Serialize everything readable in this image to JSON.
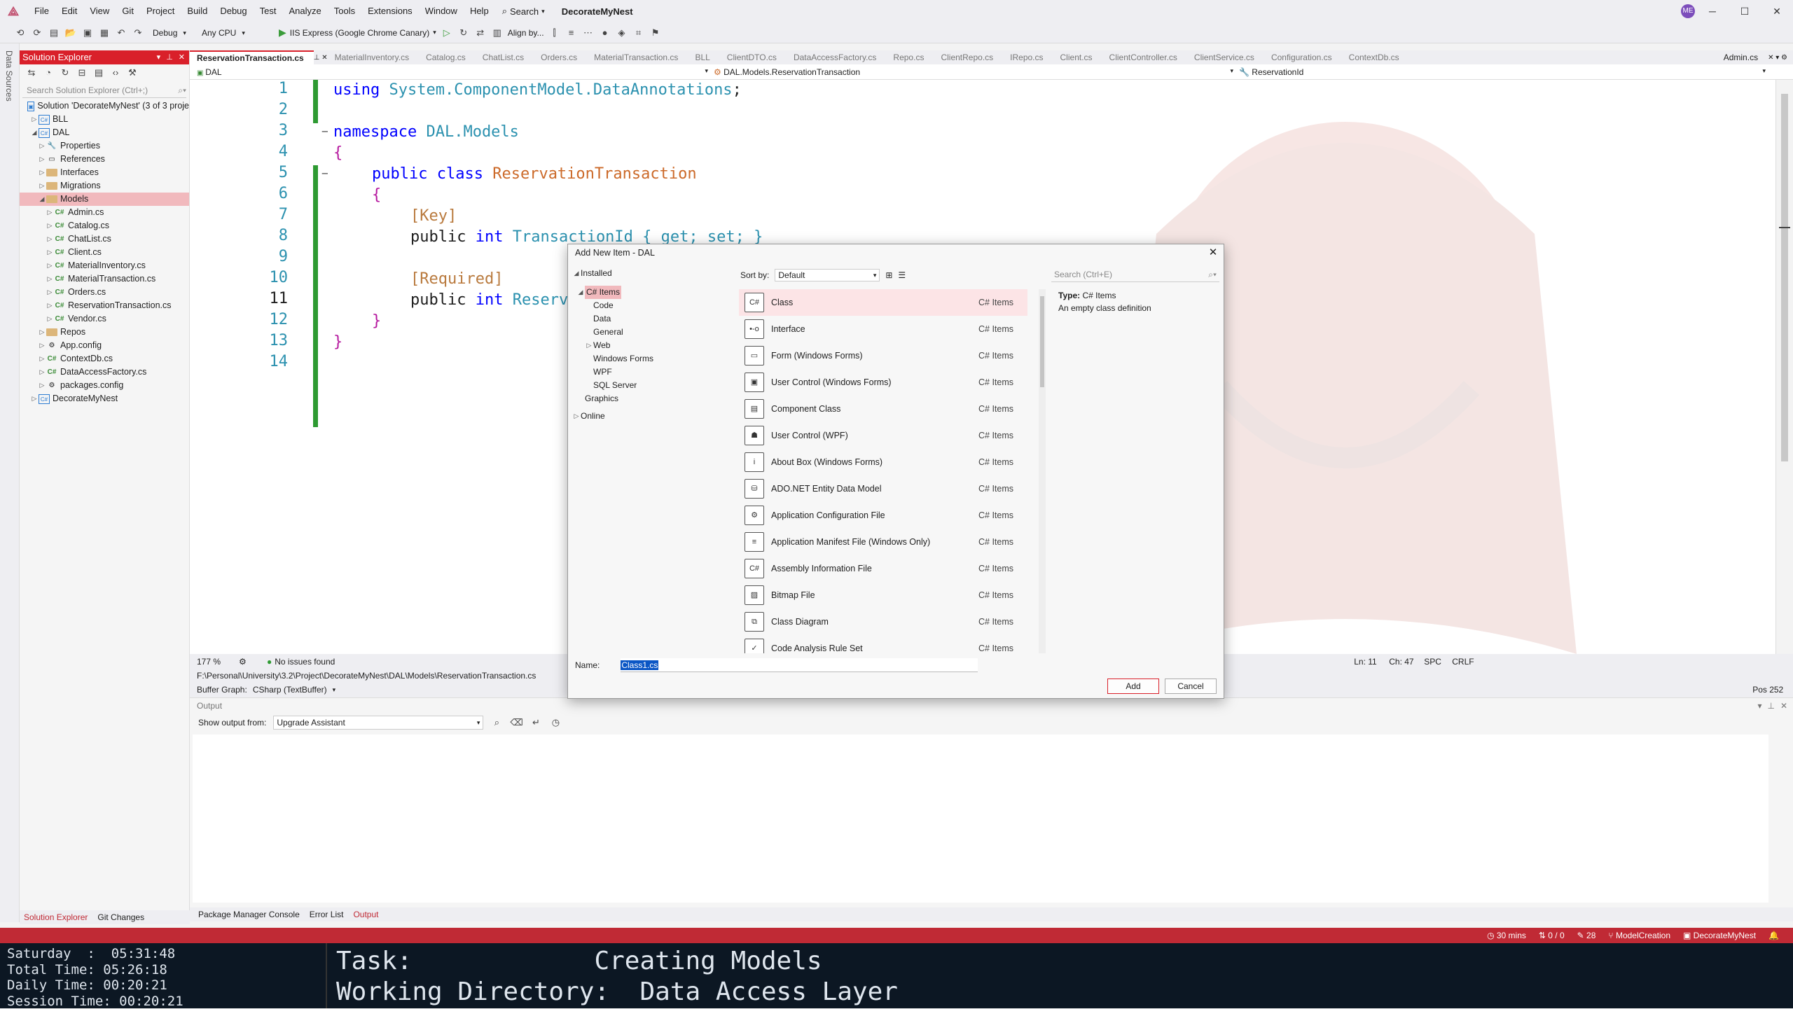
{
  "menubar": {
    "items": [
      "File",
      "Edit",
      "View",
      "Git",
      "Project",
      "Build",
      "Debug",
      "Test",
      "Analyze",
      "Tools",
      "Extensions",
      "Window",
      "Help"
    ],
    "search": "Search",
    "solution_name": "DecorateMyNest",
    "avatar_initials": "ME"
  },
  "toolbar": {
    "config": "Debug",
    "platform": "Any CPU",
    "run_target": "IIS Express (Google Chrome Canary)",
    "align": "Align by..."
  },
  "sidestrip": {
    "label": "Data Sources"
  },
  "solution_explorer": {
    "title": "Solution Explorer",
    "search_placeholder": "Search Solution Explorer (Ctrl+;)",
    "tree": [
      {
        "label": "Solution 'DecorateMyNest' (3 of 3 proje",
        "depth": 0,
        "kind": "solution"
      },
      {
        "label": "BLL",
        "depth": 1,
        "kind": "proj"
      },
      {
        "label": "DAL",
        "depth": 1,
        "kind": "proj"
      },
      {
        "label": "Properties",
        "depth": 2,
        "kind": "prop"
      },
      {
        "label": "References",
        "depth": 2,
        "kind": "ref"
      },
      {
        "label": "Interfaces",
        "depth": 2,
        "kind": "folder"
      },
      {
        "label": "Migrations",
        "depth": 2,
        "kind": "folder"
      },
      {
        "label": "Models",
        "depth": 2,
        "kind": "folder",
        "selected": true
      },
      {
        "label": "Admin.cs",
        "depth": 3,
        "kind": "cs"
      },
      {
        "label": "Catalog.cs",
        "depth": 3,
        "kind": "cs"
      },
      {
        "label": "ChatList.cs",
        "depth": 3,
        "kind": "cs"
      },
      {
        "label": "Client.cs",
        "depth": 3,
        "kind": "cs"
      },
      {
        "label": "MaterialInventory.cs",
        "depth": 3,
        "kind": "cs"
      },
      {
        "label": "MaterialTransaction.cs",
        "depth": 3,
        "kind": "cs"
      },
      {
        "label": "Orders.cs",
        "depth": 3,
        "kind": "cs"
      },
      {
        "label": "ReservationTransaction.cs",
        "depth": 3,
        "kind": "cs"
      },
      {
        "label": "Vendor.cs",
        "depth": 3,
        "kind": "cs"
      },
      {
        "label": "Repos",
        "depth": 2,
        "kind": "folder"
      },
      {
        "label": "App.config",
        "depth": 2,
        "kind": "config"
      },
      {
        "label": "ContextDb.cs",
        "depth": 2,
        "kind": "cs"
      },
      {
        "label": "DataAccessFactory.cs",
        "depth": 2,
        "kind": "cs"
      },
      {
        "label": "packages.config",
        "depth": 2,
        "kind": "config"
      },
      {
        "label": "DecorateMyNest",
        "depth": 1,
        "kind": "proj"
      }
    ],
    "bottom_tabs": [
      "Solution Explorer",
      "Git Changes"
    ]
  },
  "tabs": [
    "ReservationTransaction.cs",
    "MaterialInventory.cs",
    "Catalog.cs",
    "ChatList.cs",
    "Orders.cs",
    "MaterialTransaction.cs",
    "BLL",
    "ClientDTO.cs",
    "DataAccessFactory.cs",
    "Repo.cs",
    "ClientRepo.cs",
    "IRepo.cs",
    "Client.cs",
    "ClientController.cs",
    "ClientService.cs",
    "Configuration.cs",
    "ContextDb.cs"
  ],
  "right_tab": "Admin.cs",
  "navbar": {
    "project": "DAL",
    "type": "DAL.Models.ReservationTransaction",
    "member": "ReservationId"
  },
  "code": {
    "line_numbers": [
      "1",
      "2",
      "3",
      "4",
      "5",
      "6",
      "7",
      "8",
      "9",
      "10",
      "11",
      "12",
      "13",
      "14"
    ],
    "l1_kw": "using",
    "l1_ns": "System.ComponentModel.DataAnnotations",
    "l1_end": ";",
    "l3_kw": "namespace",
    "l3_ns": "DAL.Models",
    "open_brace": "{",
    "close_brace": "}",
    "l5_kw1": "public",
    "l5_kw2": "class",
    "l5_cls": "ReservationTransaction",
    "l7_attr": "[Key]",
    "l8_kw1": "public",
    "l8_kw2": "int",
    "l8_rest": "TransactionId { get; set; }",
    "l10_attr": "[Required]",
    "l11_kw1": "public",
    "l11_kw2": "int",
    "l11_rest": "Reserv"
  },
  "editor_status": {
    "zoom": "177 %",
    "issues": "No issues found",
    "ln": "Ln: 11",
    "ch": "Ch: 47",
    "spc": "SPC",
    "crlf": "CRLF"
  },
  "path": "F:\\Personal\\University\\3.2\\Project\\DecorateMyNest\\DAL\\Models\\ReservationTransaction.cs",
  "buffer": {
    "label": "Buffer Graph:",
    "value": "CSharp (TextBuffer)",
    "pos": "Pos 252"
  },
  "output": {
    "title": "Output",
    "show_label": "Show output from:",
    "source": "Upgrade Assistant"
  },
  "output_tabs": [
    "Package Manager Console",
    "Error List",
    "Output"
  ],
  "statusbar": {
    "timer": "30 mins",
    "sync": "0 / 0",
    "edits": "28",
    "branch": "ModelCreation",
    "repo": "DecorateMyNest"
  },
  "timepanel": {
    "left": "Saturday  :  05:31:48\nTotal Time: 05:26:18\nDaily Time: 00:20:21\nSession Time: 00:20:21",
    "right": "Task:            Creating Models\nWorking Directory:  Data Access Layer"
  },
  "dialog": {
    "title": "Add New Item - DAL",
    "installed": "Installed",
    "categories": [
      {
        "label": "C# Items",
        "depth": 1,
        "selected": true
      },
      {
        "label": "Code",
        "depth": 2
      },
      {
        "label": "Data",
        "depth": 2
      },
      {
        "label": "General",
        "depth": 2
      },
      {
        "label": "Web",
        "depth": 2,
        "expandable": true
      },
      {
        "label": "Windows Forms",
        "depth": 2
      },
      {
        "label": "WPF",
        "depth": 2
      },
      {
        "label": "SQL Server",
        "depth": 2
      },
      {
        "label": "Graphics",
        "depth": 1
      }
    ],
    "online": "Online",
    "sort_label": "Sort by:",
    "sort_value": "Default",
    "search_placeholder": "Search (Ctrl+E)",
    "templates": [
      {
        "name": "Class",
        "category": "C# Items",
        "icon": "C#"
      },
      {
        "name": "Interface",
        "category": "C# Items",
        "icon": "•-o"
      },
      {
        "name": "Form (Windows Forms)",
        "category": "C# Items",
        "icon": "▭"
      },
      {
        "name": "User Control (Windows Forms)",
        "category": "C# Items",
        "icon": "▣"
      },
      {
        "name": "Component Class",
        "category": "C# Items",
        "icon": "▤"
      },
      {
        "name": "User Control (WPF)",
        "category": "C# Items",
        "icon": "☗"
      },
      {
        "name": "About Box (Windows Forms)",
        "category": "C# Items",
        "icon": "i"
      },
      {
        "name": "ADO.NET Entity Data Model",
        "category": "C# Items",
        "icon": "⛁"
      },
      {
        "name": "Application Configuration File",
        "category": "C# Items",
        "icon": "⚙"
      },
      {
        "name": "Application Manifest File (Windows Only)",
        "category": "C# Items",
        "icon": "≡"
      },
      {
        "name": "Assembly Information File",
        "category": "C# Items",
        "icon": "C#"
      },
      {
        "name": "Bitmap File",
        "category": "C# Items",
        "icon": "▨"
      },
      {
        "name": "Class Diagram",
        "category": "C# Items",
        "icon": "⧉"
      },
      {
        "name": "Code Analysis Rule Set",
        "category": "C# Items",
        "icon": "✓"
      }
    ],
    "type_label": "Type:",
    "type_value": "C# Items",
    "description": "An empty class definition",
    "name_label": "Name:",
    "name_value": "Class1.cs",
    "add": "Add",
    "cancel": "Cancel"
  }
}
